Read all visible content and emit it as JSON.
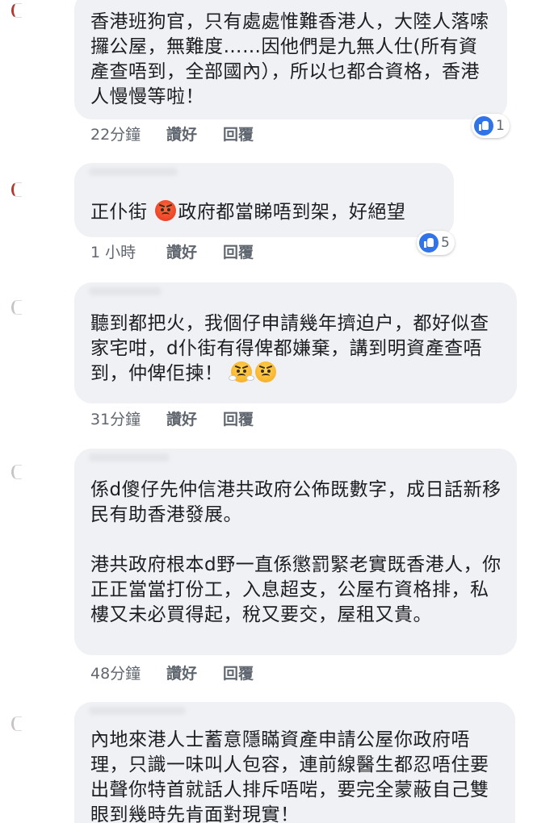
{
  "comments": [
    {
      "lines": [
        "香港班狗官，只有處處惟難香港人，大陸人落嗦攞公屋，無難度……因他們是九無人仕(所有資產查唔到，全部國內），所以乜都合資格，香港人慢慢等啦！"
      ],
      "time": "22分鐘",
      "like": "讚好",
      "reply": "回覆",
      "reaction_count": "1"
    },
    {
      "text_before": "正仆街 ",
      "emoji": "angry-face-icon",
      "text_after": "政府都當睇唔到架，好絕望",
      "time": "1 小時",
      "like": "讚好",
      "reply": "回覆",
      "reaction_count": "5"
    },
    {
      "text": "聽到都把火，我個仔申請幾年擠迫户，都好似查家宅咁，d仆街有得俾都嫌棄，講到明資產查唔到，仲俾佢揀！",
      "emojis": [
        "steam-face-icon",
        "angry-face-icon"
      ],
      "time": "31分鐘",
      "like": "讚好",
      "reply": "回覆"
    },
    {
      "paragraphs": [
        "係d傻仔先仲信港共政府公佈既數字，成日話新移民有助香港發展。",
        "港共政府根本d野一直係懲罰緊老實既香港人，你正正當當打份工，入息超支，公屋冇資格排，私樓又未必買得起，稅又要交，屋租又貴。"
      ],
      "time": "48分鐘",
      "like": "讚好",
      "reply": "回覆"
    },
    {
      "text": "內地來港人士蓄意隱瞞資產申請公屋你政府唔理，只識一味叫人包容，連前線醫生都忍唔住要出聲你特首就話人排斥唔啱，要完全蒙蔽自己雙眼到幾時先肯面對現實！"
    }
  ],
  "colors": {
    "bubble": "#f0f1f4",
    "text": "#1c1e21",
    "meta": "#606770",
    "like_blue": "#2f74e8"
  }
}
